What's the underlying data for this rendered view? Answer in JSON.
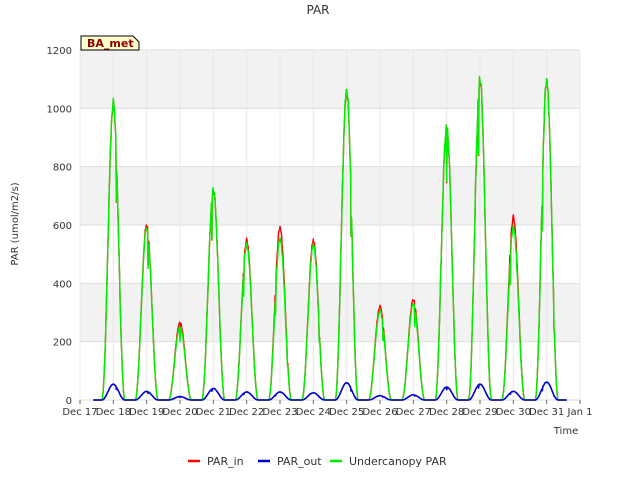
{
  "chart_data": {
    "type": "line",
    "title": "PAR",
    "xlabel": "Time",
    "ylabel": "PAR (umol/m2/s)",
    "badge": "BA_met",
    "ylim": [
      0,
      1200
    ],
    "xlim": [
      0,
      15
    ],
    "x_unit": "days after Dec 17",
    "yticks": [
      0,
      200,
      400,
      600,
      800,
      1000,
      1200
    ],
    "xticks": [
      {
        "pos": 0,
        "label": "Dec 17"
      },
      {
        "pos": 1,
        "label": "Dec 18"
      },
      {
        "pos": 2,
        "label": "Dec 19"
      },
      {
        "pos": 3,
        "label": "Dec 20"
      },
      {
        "pos": 4,
        "label": "Dec 21"
      },
      {
        "pos": 5,
        "label": "Dec 22"
      },
      {
        "pos": 6,
        "label": "Dec 23"
      },
      {
        "pos": 7,
        "label": "Dec 24"
      },
      {
        "pos": 8,
        "label": "Dec 25"
      },
      {
        "pos": 9,
        "label": "Dec 26"
      },
      {
        "pos": 10,
        "label": "Dec 27"
      },
      {
        "pos": 11,
        "label": "Dec 28"
      },
      {
        "pos": 12,
        "label": "Dec 29"
      },
      {
        "pos": 13,
        "label": "Dec 30"
      },
      {
        "pos": 14,
        "label": "Dec 31"
      },
      {
        "pos": 15,
        "label": "Jan 1"
      }
    ],
    "grid": true,
    "background_bands": true,
    "legend_position": "bottom",
    "series": [
      {
        "name": "PAR_in",
        "color": "#ff0000",
        "peaks": [
          {
            "day": 0,
            "value": 1030
          },
          {
            "day": 1,
            "value": 610
          },
          {
            "day": 2,
            "value": 270
          },
          {
            "day": 3,
            "value": 730
          },
          {
            "day": 4,
            "value": 555
          },
          {
            "day": 5,
            "value": 600
          },
          {
            "day": 6,
            "value": 555
          },
          {
            "day": 7,
            "value": 1075
          },
          {
            "day": 8,
            "value": 325
          },
          {
            "day": 9,
            "value": 350
          },
          {
            "day": 10,
            "value": 950
          },
          {
            "day": 11,
            "value": 1115
          },
          {
            "day": 12,
            "value": 635
          },
          {
            "day": 13,
            "value": 1110
          }
        ]
      },
      {
        "name": "PAR_out",
        "color": "#0000cc",
        "peaks": [
          {
            "day": 0,
            "value": 55
          },
          {
            "day": 1,
            "value": 30
          },
          {
            "day": 2,
            "value": 12
          },
          {
            "day": 3,
            "value": 40
          },
          {
            "day": 4,
            "value": 28
          },
          {
            "day": 5,
            "value": 28
          },
          {
            "day": 6,
            "value": 25
          },
          {
            "day": 7,
            "value": 60
          },
          {
            "day": 8,
            "value": 15
          },
          {
            "day": 9,
            "value": 18
          },
          {
            "day": 10,
            "value": 45
          },
          {
            "day": 11,
            "value": 55
          },
          {
            "day": 12,
            "value": 30
          },
          {
            "day": 13,
            "value": 62
          }
        ]
      },
      {
        "name": "Undercanopy PAR",
        "color": "#00ee00",
        "peaks": [
          {
            "day": 0,
            "value": 1035
          },
          {
            "day": 1,
            "value": 600
          },
          {
            "day": 2,
            "value": 255
          },
          {
            "day": 3,
            "value": 735
          },
          {
            "day": 4,
            "value": 540
          },
          {
            "day": 5,
            "value": 560
          },
          {
            "day": 6,
            "value": 540
          },
          {
            "day": 7,
            "value": 1080
          },
          {
            "day": 8,
            "value": 310
          },
          {
            "day": 9,
            "value": 335
          },
          {
            "day": 10,
            "value": 955
          },
          {
            "day": 11,
            "value": 1120
          },
          {
            "day": 12,
            "value": 600
          },
          {
            "day": 13,
            "value": 1110
          }
        ]
      }
    ]
  }
}
